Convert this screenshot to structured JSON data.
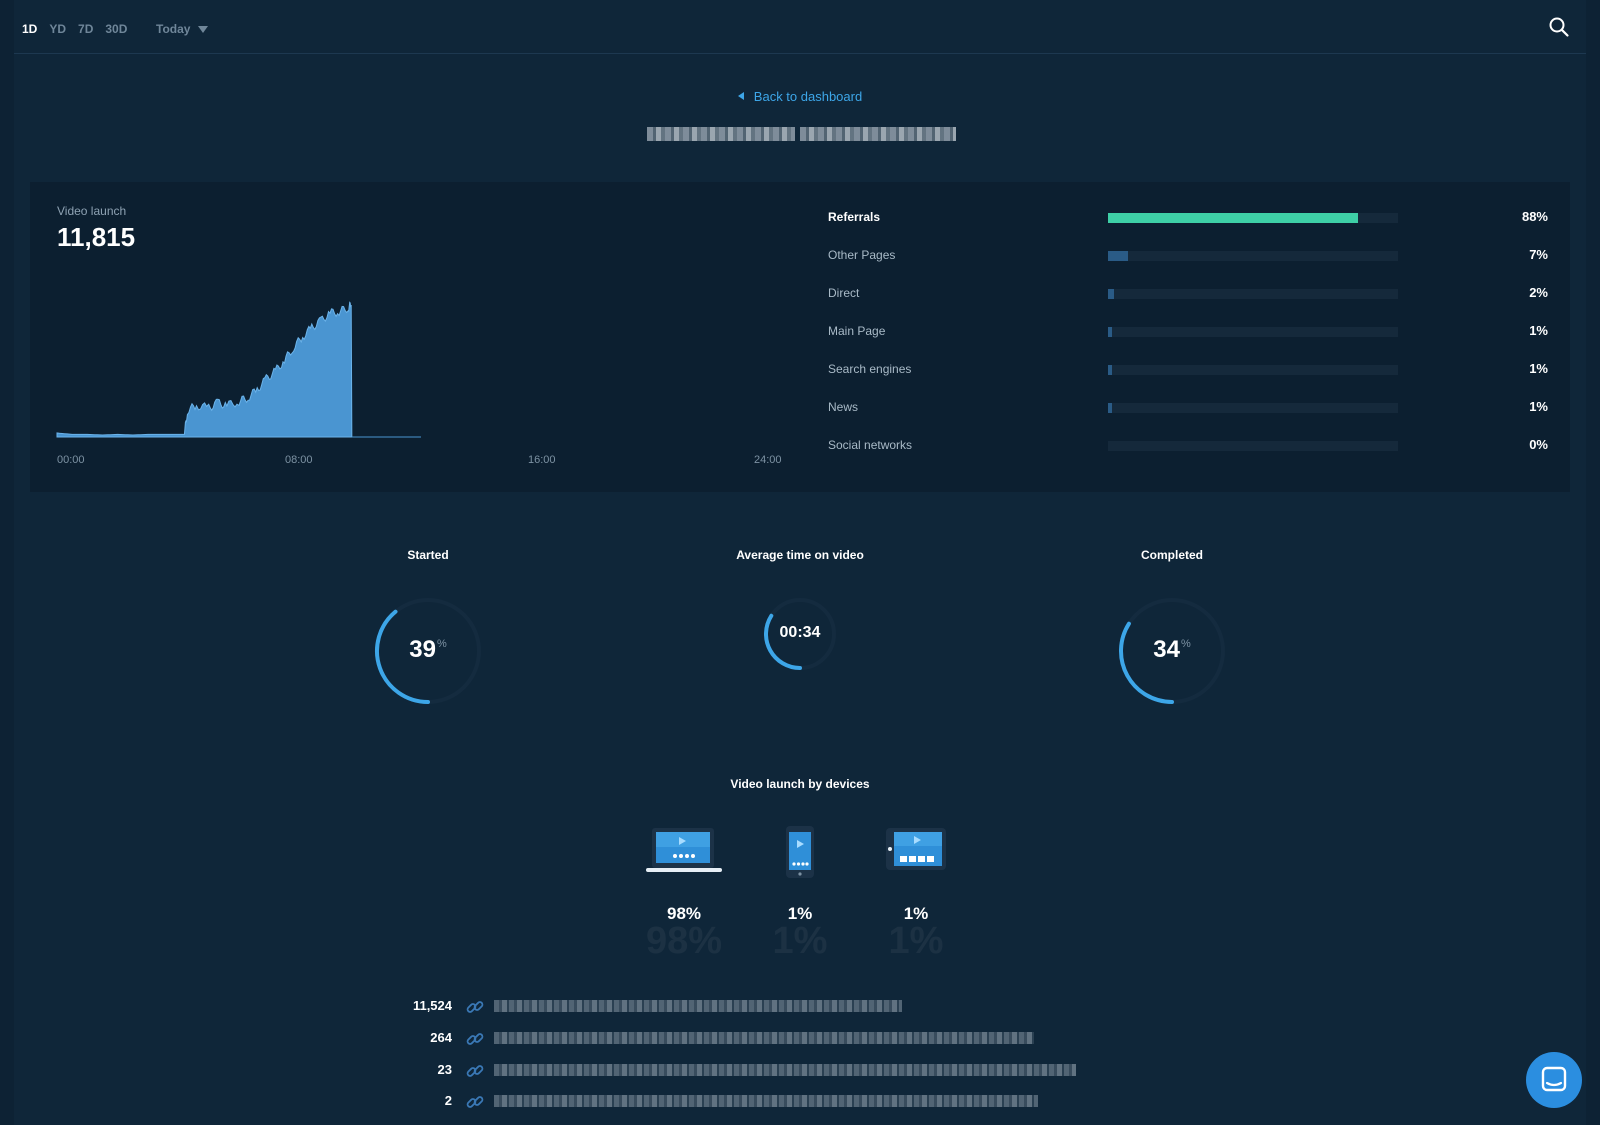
{
  "header": {
    "range_tabs": [
      {
        "label": "1D",
        "active": true
      },
      {
        "label": "YD",
        "active": false
      },
      {
        "label": "7D",
        "active": false
      },
      {
        "label": "30D",
        "active": false
      }
    ],
    "period_label": "Today",
    "search_icon": "search-icon"
  },
  "back_link": "Back to dashboard",
  "video_launch": {
    "label": "Video launch",
    "value": "11,815"
  },
  "chart_data": {
    "type": "area",
    "title": "",
    "x_ticks": [
      "00:00",
      "08:00",
      "16:00",
      "24:00"
    ],
    "x_domain_hours": [
      0,
      24
    ],
    "y_range": [
      0,
      100
    ],
    "series_color": "#4a95d1",
    "points": [
      [
        0.0,
        3
      ],
      [
        0.5,
        2
      ],
      [
        1.0,
        2
      ],
      [
        1.5,
        1.5
      ],
      [
        2.0,
        2
      ],
      [
        2.5,
        1.5
      ],
      [
        3.0,
        2
      ],
      [
        3.5,
        2
      ],
      [
        4.0,
        2
      ],
      [
        4.2,
        2
      ],
      [
        4.3,
        20
      ],
      [
        4.6,
        24
      ],
      [
        5.0,
        22
      ],
      [
        5.3,
        26
      ],
      [
        5.6,
        24
      ],
      [
        6.0,
        27
      ],
      [
        6.3,
        30
      ],
      [
        6.6,
        36
      ],
      [
        6.9,
        44
      ],
      [
        7.2,
        50
      ],
      [
        7.5,
        58
      ],
      [
        7.8,
        68
      ],
      [
        8.1,
        76
      ],
      [
        8.4,
        83
      ],
      [
        8.7,
        88
      ],
      [
        9.0,
        94
      ],
      [
        9.3,
        95
      ],
      [
        9.6,
        98
      ],
      [
        9.7,
        100
      ],
      [
        9.72,
        0
      ]
    ]
  },
  "referrals": [
    {
      "label": "Referrals",
      "pct": "88%",
      "value": 0.88,
      "bold": true,
      "color": "#3ecfa6"
    },
    {
      "label": "Other Pages",
      "pct": "7%",
      "value": 0.07,
      "bold": false,
      "color": "#2a5b86"
    },
    {
      "label": "Direct",
      "pct": "2%",
      "value": 0.02,
      "bold": false,
      "color": "#2a5b86"
    },
    {
      "label": "Main Page",
      "pct": "1%",
      "value": 0.01,
      "bold": false,
      "color": "#2a5b86"
    },
    {
      "label": "Search engines",
      "pct": "1%",
      "value": 0.01,
      "bold": false,
      "color": "#2a5b86"
    },
    {
      "label": "News",
      "pct": "1%",
      "value": 0.01,
      "bold": false,
      "color": "#2a5b86"
    },
    {
      "label": "Social networks",
      "pct": "0%",
      "value": 0.0,
      "bold": false,
      "color": "#2a5b86"
    }
  ],
  "gauges": [
    {
      "label": "Started",
      "value": "39",
      "unit": "%",
      "fraction": 0.39
    },
    {
      "label": "Average time on video",
      "value": "00:34",
      "unit": "",
      "fraction": 0.34
    },
    {
      "label": "Completed",
      "value": "34",
      "unit": "%",
      "fraction": 0.34
    }
  ],
  "devices": {
    "title": "Video launch by devices",
    "items": [
      {
        "name": "laptop-icon",
        "pct": "98%"
      },
      {
        "name": "phone-icon",
        "pct": "1%"
      },
      {
        "name": "tablet-icon",
        "pct": "1%"
      }
    ]
  },
  "urls": [
    {
      "count": "11,524"
    },
    {
      "count": "264"
    },
    {
      "count": "23"
    },
    {
      "count": "2"
    }
  ],
  "colors": {
    "background": "#0f2639",
    "panel": "#0c1f30",
    "accent": "#3da6e8",
    "referral_accent": "#3ecfa6"
  }
}
